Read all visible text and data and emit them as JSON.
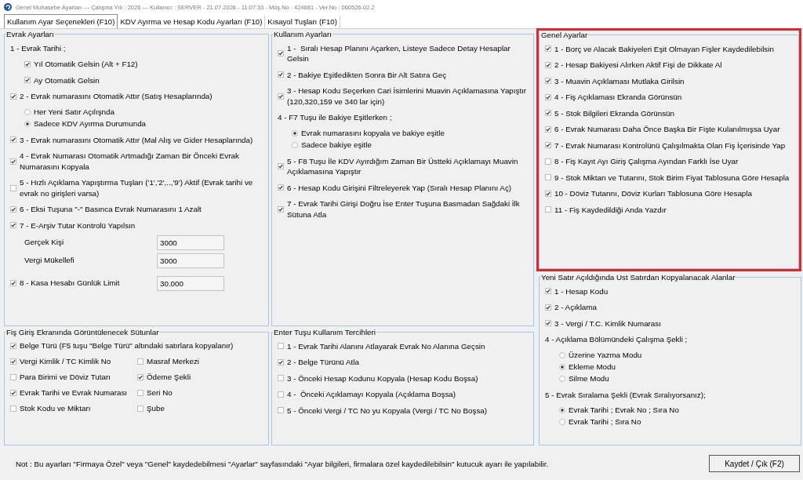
{
  "window": {
    "title": "Genel Muhasebe Ayarları --- Çalışma Yılı : 2026 --- Kullanıcı : SERVER - 21.07.2026 - 11:07:33 - Müş.No : 424681 - Ver.No : 060526-02.2"
  },
  "tabs": [
    {
      "label": "Kullanım Ayar Seçenekleri (F10)",
      "selected": true
    },
    {
      "label": "KDV Ayırma ve Hesap Kodu Ayarları (F10)",
      "selected": false
    },
    {
      "label": "Kısayol Tuşları (F10)",
      "selected": false
    }
  ],
  "columns": [
    {
      "panels": [
        {
          "title": "Evrak Ayarları",
          "items": [
            {
              "kind": "heading",
              "label": "1 - Evrak Tarihi ;",
              "children": [
                {
                  "kind": "checkbox",
                  "label": "Yıl Otomatik Gelsin (Alt + F12)",
                  "checked": true
                },
                {
                  "kind": "checkbox",
                  "label": "Ay Otomatik Gelsin",
                  "checked": true
                }
              ]
            },
            {
              "kind": "checkbox",
              "label": "2 - Evrak numarasını Otomatik Attır (Satış Hesaplarında)",
              "checked": true,
              "children": [
                {
                  "kind": "radio",
                  "label": "Her Yeni Satır Açılışnda",
                  "selected": false
                },
                {
                  "kind": "radio",
                  "label": "Sadece KDV Ayırma Durumunda",
                  "selected": true
                }
              ]
            },
            {
              "kind": "checkbox",
              "label": "3 - Evrak numarasını Otomatik Attır (Mal Alış ve Gider Hesaplarında)",
              "checked": true
            },
            {
              "kind": "checkbox",
              "label": "4 - Evrak Numarası Otomatik Artmadığı Zaman Bir Önceki Evrak Numarasını Kopyala",
              "checked": true
            },
            {
              "kind": "checkbox",
              "label": "5 - Hızlı Açıklama Yapıştırma Tuşları ('1','2',..,'9') Aktif (Evrak tarihi ve evrak no girişleri varsa)",
              "checked": false
            },
            {
              "kind": "checkbox",
              "label": "6 - Eksi Tuşuna \"-\" Basınca Evrak Numarasını 1 Azalt",
              "checked": true
            },
            {
              "kind": "checkbox",
              "label": "7 - E-Arşiv Tutar Kontrolü Yapılsın",
              "checked": true,
              "children": [
                {
                  "kind": "field",
                  "label": "Gerçek Kişi",
                  "value": "3000"
                },
                {
                  "kind": "field",
                  "label": "Vergi Mükellefi",
                  "value": "3000"
                }
              ]
            },
            {
              "kind": "checkbox_field",
              "label": "8 - Kasa Hesabı Günlük Limit",
              "checked": true,
              "value": "30.000"
            }
          ]
        },
        {
          "title": "Fiş Giriş Ekranında Görüntülenecek Sütunlar",
          "rows": [
            {
              "cells": [
                {
                  "label": "Belge Türü (F5 tuşu \"Belge Türü\" altındaki satırlara kopyalanır)",
                  "checked": true
                }
              ]
            },
            {
              "cells": [
                {
                  "label": "Vergi Kimlik / TC Kimlik No",
                  "checked": true
                },
                {
                  "label": "Masraf Merkezi",
                  "checked": false
                }
              ]
            },
            {
              "cells": [
                {
                  "label": "Para Birimi ve Döviz Tutarı",
                  "checked": false
                },
                {
                  "label": "Ödeme Şekli",
                  "checked": true
                }
              ]
            },
            {
              "cells": [
                {
                  "label": "Evrak Tarihi ve Evrak Numarası",
                  "checked": true
                },
                {
                  "label": "Seri No",
                  "checked": false
                }
              ]
            },
            {
              "cells": [
                {
                  "label": "Stok Kodu ve Miktarı",
                  "checked": false
                },
                {
                  "label": "Şube",
                  "checked": false
                }
              ]
            }
          ]
        }
      ]
    },
    {
      "panels": [
        {
          "title": "Kullanım Ayarları",
          "items": [
            {
              "kind": "checkbox",
              "label": "1 -  Sıralı Hesap Planını Açarken, Listeye Sadece Detay Hesaplar Gelsin",
              "checked": true
            },
            {
              "kind": "checkbox",
              "label": "2 - Bakiye Eşitledikten Sonra Bir Alt Satıra Geç",
              "checked": true
            },
            {
              "kind": "checkbox",
              "label": "3 - Hesap Kodu Seçerken Cari İsimlerini Muavin Açıklamasına Yapıştır (120,320,159 ve 340 lar için)",
              "checked": true
            },
            {
              "kind": "heading",
              "label": "4 - F7 Tuşu ile Bakiye Eşitlerken ;",
              "children": [
                {
                  "kind": "radio",
                  "label": "Evrak numarasını kopyala ve bakiye eşitle",
                  "selected": true
                },
                {
                  "kind": "radio",
                  "label": "Sadece bakiye eşitle",
                  "selected": false
                }
              ]
            },
            {
              "kind": "checkbox",
              "label": "5 - F8 Tuşu İle KDV Ayırdığım Zaman Bir Üstteki Açıklamayı Muavin Açıklamasına Yapıştır",
              "checked": true
            },
            {
              "kind": "checkbox",
              "label": "6 - Hesap Kodu Girişini Filtreleyerek Yap (Sıralı Hesap Planını Aç)",
              "checked": true
            },
            {
              "kind": "checkbox",
              "label": "7 - Evrak Tarihi Girişi Doğru İse Enter Tuşuna Basmadan Sağdaki İlk Sütuna Atla",
              "checked": true
            }
          ]
        },
        {
          "title": "Enter Tuşu Kullanım Tercihleri",
          "items": [
            {
              "kind": "checkbox",
              "label": "1 - Evrak Tarihi Alanını Atlayarak Evrak No Alanına Geçsin",
              "checked": false
            },
            {
              "kind": "checkbox",
              "label": "2 - Belge Türünü Atla",
              "checked": true
            },
            {
              "kind": "checkbox",
              "label": "3 - Önceki Hesap Kodunu Kopyala (Hesap Kodu Boşsa)",
              "checked": false
            },
            {
              "kind": "checkbox",
              "label": "4 -  Önceki Açıklamayı Kopyala (Açıklama Boşsa)",
              "checked": false
            },
            {
              "kind": "checkbox",
              "label": "5 - Önceki Vergi / TC No yu Kopyala (Vergi / TC No Boşsa)",
              "checked": false
            }
          ]
        }
      ]
    },
    {
      "panels": [
        {
          "title": "Genel Ayarlar",
          "highlighted": true,
          "items": [
            {
              "kind": "checkbox",
              "label": "1 - Borç ve Alacak Bakiyeleri Eşit Olmayan Fişler Kaydedilebilsin",
              "checked": true
            },
            {
              "kind": "checkbox",
              "label": "2 - Hesap Bakiyesi Alırken Aktif Fişi de Dikkate Al",
              "checked": true
            },
            {
              "kind": "checkbox",
              "label": "3 - Muavin Açıklaması Mutlaka Girilsin",
              "checked": true
            },
            {
              "kind": "checkbox",
              "label": "4 - Fiş Açıklaması Ekranda Görünsün",
              "checked": true
            },
            {
              "kind": "checkbox",
              "label": "5 - Stok Bilgileri Ekranda Görünsün",
              "checked": true
            },
            {
              "kind": "checkbox",
              "label": "6 - Evrak Numarası Daha Önce Başka Bir Fişte Kulanılmışsa Uyar",
              "checked": true
            },
            {
              "kind": "checkbox",
              "label": "7 - Evrak Numarası Kontrolünü Çalışılmakta Olan Fiş İçerisinde Yap",
              "checked": true
            },
            {
              "kind": "checkbox",
              "label": "8 - Fiş Kayıt Ayı Giriş Çalışma Ayından Farklı İse Uyar",
              "checked": false
            },
            {
              "kind": "checkbox",
              "label": "9 - Stok Miktarı ve Tutarını, Stok Birim Fiyat Tablosuna Göre Hesapla",
              "checked": false
            },
            {
              "kind": "checkbox",
              "label": "10 - Döviz Tutarını, Döviz Kurları Tablosuna Göre Hesapla",
              "checked": true
            },
            {
              "kind": "checkbox",
              "label": "11 - Fiş Kaydedildiği Anda Yazdır",
              "checked": false
            }
          ]
        },
        {
          "title": "Yeni Satır Açıldığında Ust Satırdan Kopyalanacak Alanlar",
          "items": [
            {
              "kind": "checkbox",
              "label": "1 - Hesap Kodu",
              "checked": true
            },
            {
              "kind": "checkbox",
              "label": "2 - Açıklama",
              "checked": true
            },
            {
              "kind": "checkbox",
              "label": "3 - Vergi / T.C. Kimlik Numarası",
              "checked": true
            },
            {
              "kind": "heading",
              "label": "4 - Açıklama Bölümündeki Çalışma Şekli ;",
              "children": [
                {
                  "kind": "radio",
                  "label": "Üzerine Yazma Modu",
                  "selected": false
                },
                {
                  "kind": "radio",
                  "label": "Ekleme Modu",
                  "selected": true
                },
                {
                  "kind": "radio",
                  "label": "Silme Modu",
                  "selected": false
                }
              ]
            },
            {
              "kind": "heading",
              "label": "5 - Evrak Sıralama Şekli (Evrak Sıralıyorsanız);",
              "children": [
                {
                  "kind": "radio",
                  "label": "Evrak Tarihi ; Evrak No ; Sıra No",
                  "selected": true
                },
                {
                  "kind": "radio",
                  "label": "Evrak Tarihi ; Sıra No",
                  "selected": false
                }
              ]
            }
          ]
        }
      ]
    }
  ],
  "footer": {
    "note": "Not : Bu ayarları \"Firmaya Özel\" veya \"Genel\" kaydedebilmesi \"Ayarlar\" sayfasındaki \"Ayar bilgileri, firmalara özel kaydedilebilsin\" kutucuk ayarı ile yapılabilir.",
    "button": "Kaydet / Çık (F2)"
  }
}
